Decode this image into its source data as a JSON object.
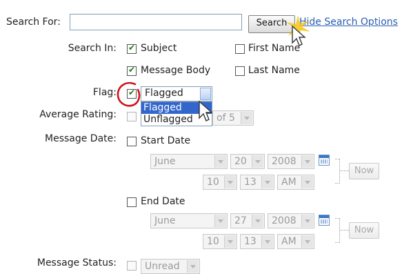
{
  "search_for": {
    "label": "Search For:",
    "value": ""
  },
  "search_button": "Search",
  "hide_options_link": "Hide Search Options",
  "search_in": {
    "label": "Search In:",
    "options": [
      {
        "label": "Subject",
        "checked": true
      },
      {
        "label": "First Name",
        "checked": false
      },
      {
        "label": "Message Body",
        "checked": true
      },
      {
        "label": "Last Name",
        "checked": false
      }
    ]
  },
  "flag": {
    "label": "Flag:",
    "checked": true,
    "selected": "Flagged",
    "options": [
      "Flagged",
      "Unflagged"
    ]
  },
  "average_rating": {
    "label": "Average Rating:",
    "suffix": "of 5"
  },
  "message_date": {
    "label": "Message Date:",
    "start": {
      "label": "Start Date",
      "month": "June",
      "day": "20",
      "year": "2008",
      "hour": "10",
      "minute": "13",
      "ampm": "AM",
      "now": "Now"
    },
    "end": {
      "label": "End Date",
      "month": "June",
      "day": "27",
      "year": "2008",
      "hour": "10",
      "minute": "13",
      "ampm": "AM",
      "now": "Now"
    }
  },
  "message_status": {
    "label": "Message Status:",
    "selected": "Unread"
  },
  "colors": {
    "link": "#2a5db0",
    "highlight": "#3366cc",
    "annotation": "#d0141b"
  }
}
